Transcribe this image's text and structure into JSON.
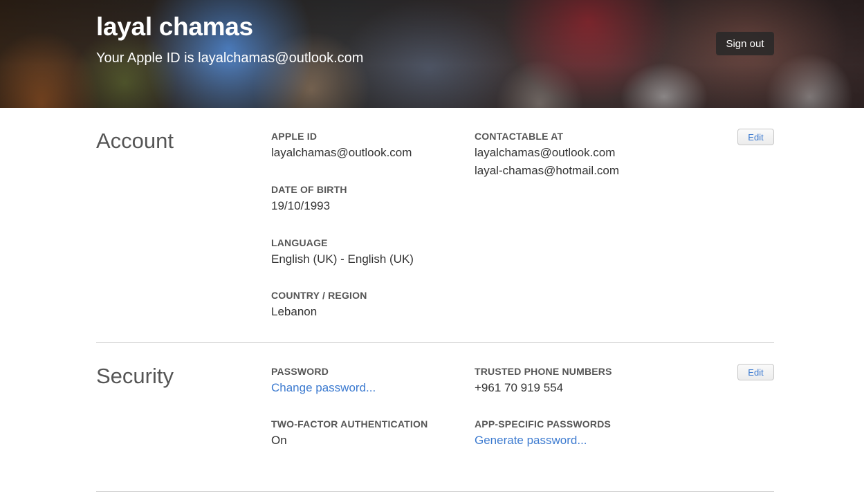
{
  "header": {
    "name": "layal chamas",
    "subtitle": "Your Apple ID is layalchamas@outlook.com",
    "sign_out_label": "Sign out"
  },
  "account": {
    "title": "Account",
    "edit_label": "Edit",
    "apple_id_label": "APPLE ID",
    "apple_id_value": "layalchamas@outlook.com",
    "dob_label": "DATE OF BIRTH",
    "dob_value": "19/10/1993",
    "language_label": "LANGUAGE",
    "language_value": "English (UK) - English (UK)",
    "country_label": "COUNTRY / REGION",
    "country_value": "Lebanon",
    "contactable_label": "CONTACTABLE AT",
    "contactable_values": [
      "layalchamas@outlook.com",
      "layal-chamas@hotmail.com"
    ]
  },
  "security": {
    "title": "Security",
    "edit_label": "Edit",
    "password_label": "PASSWORD",
    "password_link": "Change password...",
    "two_factor_label": "TWO-FACTOR AUTHENTICATION",
    "two_factor_value": "On",
    "trusted_phone_label": "TRUSTED PHONE NUMBERS",
    "trusted_phone_value": "+961 70 919 554",
    "app_passwords_label": "APP-SPECIFIC PASSWORDS",
    "app_passwords_link": "Generate password..."
  },
  "colors": {
    "link": "#3d7bd0",
    "label": "#555555",
    "text": "#333333"
  }
}
